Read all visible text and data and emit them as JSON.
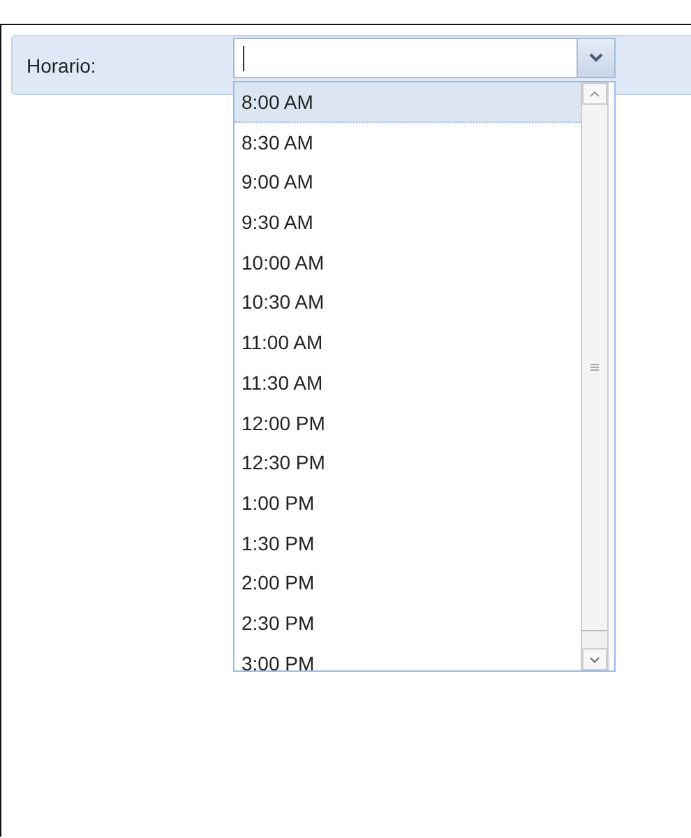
{
  "form": {
    "label": "Horario:"
  },
  "dropdown": {
    "options": [
      {
        "label": "8:00 AM",
        "selected": true
      },
      {
        "label": "8:30 AM",
        "selected": false
      },
      {
        "label": "9:00 AM",
        "selected": false
      },
      {
        "label": "9:30 AM",
        "selected": false
      },
      {
        "label": "10:00 AM",
        "selected": false
      },
      {
        "label": "10:30 AM",
        "selected": false
      },
      {
        "label": "11:00 AM",
        "selected": false
      },
      {
        "label": "11:30 AM",
        "selected": false
      },
      {
        "label": "12:00 PM",
        "selected": false
      },
      {
        "label": "12:30 PM",
        "selected": false
      },
      {
        "label": "1:00 PM",
        "selected": false
      },
      {
        "label": "1:30 PM",
        "selected": false
      },
      {
        "label": "2:00 PM",
        "selected": false
      },
      {
        "label": "2:30 PM",
        "selected": false
      },
      {
        "label": "3:00 PM",
        "selected": false
      }
    ]
  }
}
